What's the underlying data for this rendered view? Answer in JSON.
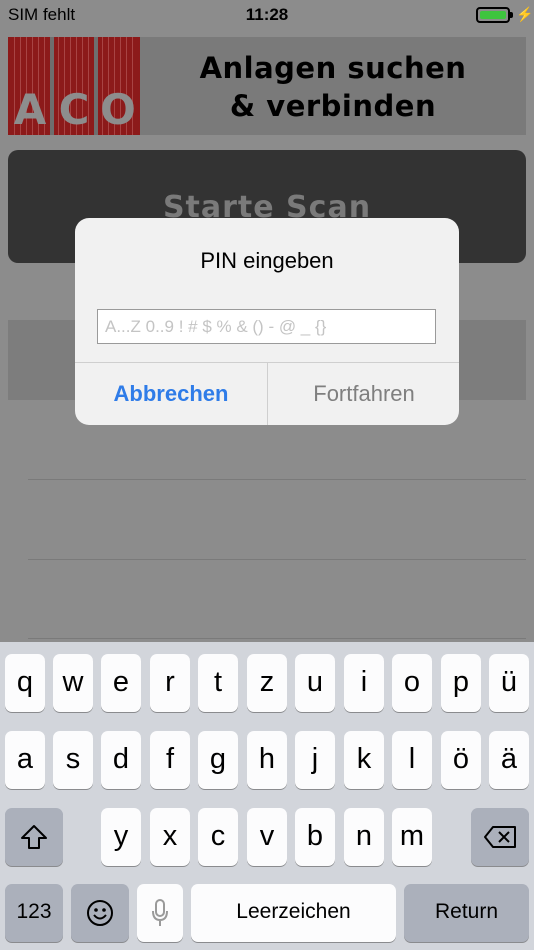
{
  "status_bar": {
    "carrier": "SIM fehlt",
    "time": "11:28",
    "battery_color": "#3ec43e"
  },
  "header": {
    "logo_letters": [
      "A",
      "C",
      "O"
    ],
    "title_line1": "Anlagen suchen",
    "title_line2": "& verbinden"
  },
  "scan_button": {
    "label": "Starte Scan"
  },
  "alert": {
    "title": "PIN eingeben",
    "input_value": "",
    "input_placeholder": "A...Z 0..9 ! # $ % & () - @ _ {}",
    "cancel_label": "Abbrechen",
    "continue_label": "Fortfahren"
  },
  "keyboard": {
    "row1": [
      "q",
      "w",
      "e",
      "r",
      "t",
      "z",
      "u",
      "i",
      "o",
      "p",
      "ü"
    ],
    "row2": [
      "a",
      "s",
      "d",
      "f",
      "g",
      "h",
      "j",
      "k",
      "l",
      "ö",
      "ä"
    ],
    "row3": [
      "y",
      "x",
      "c",
      "v",
      "b",
      "n",
      "m"
    ],
    "numbers_label": "123",
    "space_label": "Leerzeichen",
    "return_label": "Return",
    "shift_icon": "shift-icon",
    "delete_icon": "delete-icon",
    "emoji_icon": "emoji-icon",
    "mic_icon": "microphone-icon"
  }
}
